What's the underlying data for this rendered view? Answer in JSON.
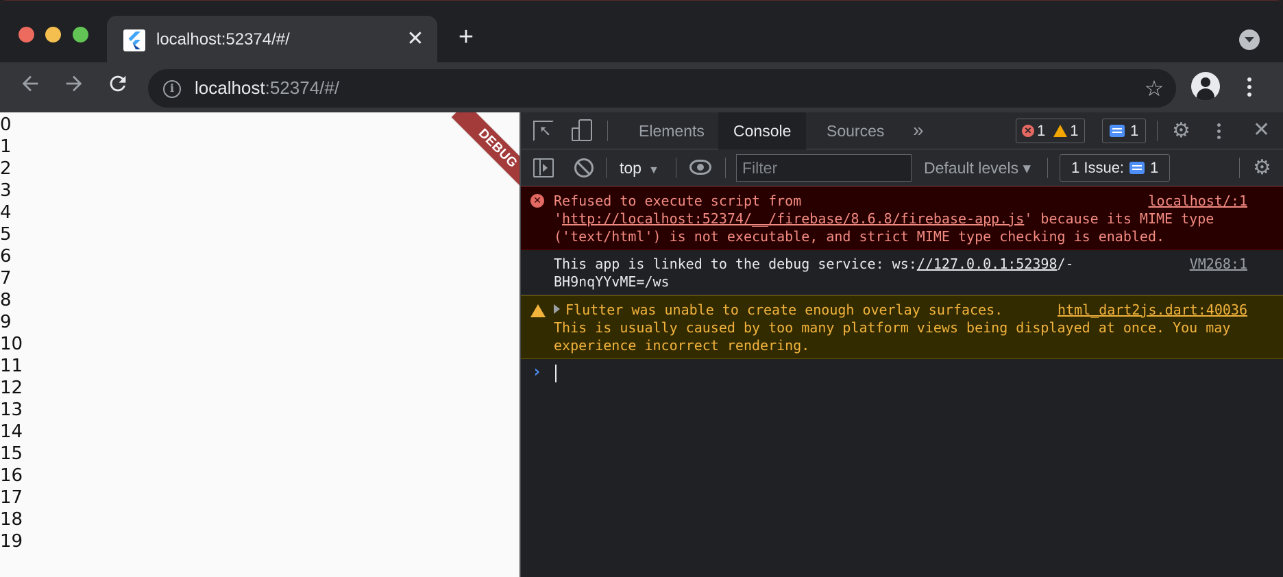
{
  "browser": {
    "tab": {
      "title": "localhost:52374/#/",
      "close_glyph": "✕"
    },
    "new_tab_glyph": "+",
    "omnibox": {
      "host": "localhost",
      "rest": ":52374/#/"
    }
  },
  "page": {
    "items": [
      "0",
      "1",
      "2",
      "3",
      "4",
      "5",
      "6",
      "7",
      "8",
      "9",
      "10",
      "11",
      "12",
      "13",
      "14",
      "15",
      "16",
      "17",
      "18",
      "19"
    ],
    "debug_banner": "DEBUG"
  },
  "devtools": {
    "tabs": [
      {
        "label": "Elements",
        "active": false
      },
      {
        "label": "Console",
        "active": true
      },
      {
        "label": "Sources",
        "active": false
      }
    ],
    "more_tabs_glyph": "»",
    "counts": {
      "errors": "1",
      "warnings": "1",
      "messages": "1"
    },
    "console_toolbar": {
      "context": "top",
      "filter_placeholder": "Filter",
      "levels": "Default levels ▾",
      "issues_label": "1 Issue:",
      "issues_count": "1"
    },
    "messages": {
      "error": {
        "source": "localhost/:1",
        "pre": "Refused to execute script from '",
        "link": "http://localhost:52374/__/firebase/8.6.8/firebase-app.js",
        "post": "' because its MIME type ('text/html') is not executable, and strict MIME type checking is enabled."
      },
      "info": {
        "source": "VM268:1",
        "pre": "This app is linked to the debug service: ws:",
        "link": "//127.0.0.1:52398",
        "post": "/-BH9nqYYvME=/ws"
      },
      "warn": {
        "source": "html_dart2js.dart:40036",
        "text": "Flutter was unable to create enough overlay surfaces. This is usually caused by too many platform views being displayed at once. You may experience incorrect rendering."
      }
    },
    "prompt_glyph": "›"
  },
  "colors": {
    "error_bg": "#290000",
    "error_text": "#f28b82",
    "warn_bg": "#332b00",
    "warn_text": "#f2b33d",
    "accent": "#4d8ff7",
    "debug_banner": "#a33b3b"
  }
}
